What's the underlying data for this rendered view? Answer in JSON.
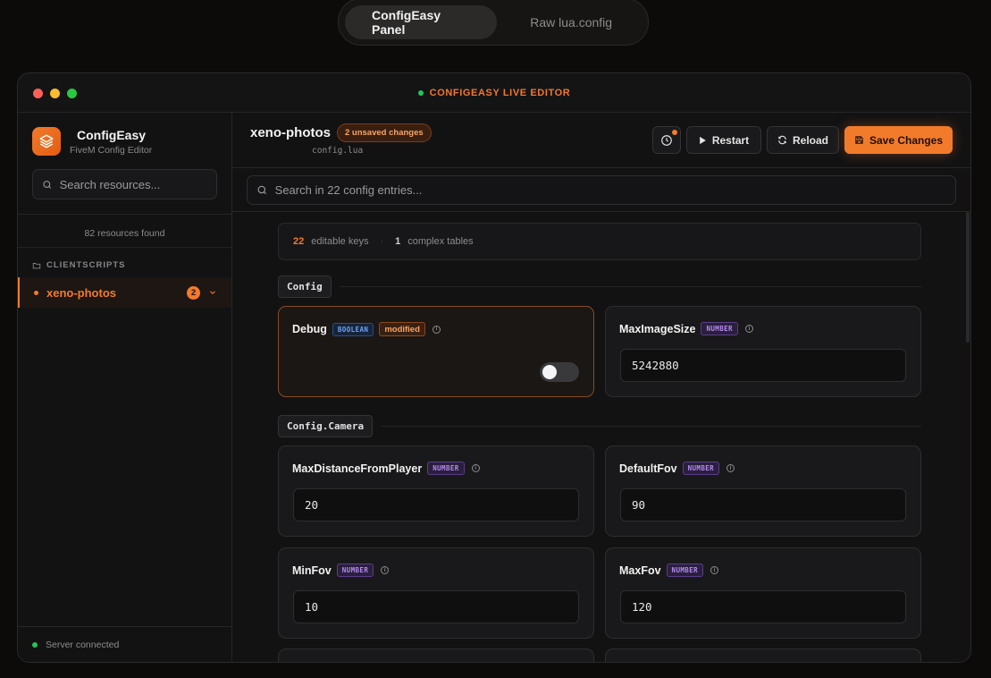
{
  "top_tabs": [
    {
      "label": "ConfigEasy Panel",
      "active": true
    },
    {
      "label": "Raw lua.config",
      "active": false
    }
  ],
  "window": {
    "title": "CONFIGEASY LIVE EDITOR"
  },
  "sidebar": {
    "brand_title": "ConfigEasy",
    "brand_subtitle": "FiveM Config Editor",
    "search_placeholder": "Search resources...",
    "resource_count": "82 resources found",
    "group_label": "CLIENTSCRIPTS",
    "items": [
      {
        "name": "xeno-photos",
        "badge": "2",
        "active": true
      }
    ],
    "footer_status": "Server connected"
  },
  "header": {
    "resource_name": "xeno-photos",
    "unsaved_badge": "2 unsaved changes",
    "file_name": "config.lua",
    "restart_label": "Restart",
    "reload_label": "Reload",
    "save_label": "Save Changes"
  },
  "search": {
    "placeholder": "Search in 22 config entries..."
  },
  "stats": {
    "editable_count": "22",
    "editable_label": "editable keys",
    "complex_count": "1",
    "complex_label": "complex tables"
  },
  "sections": [
    {
      "name": "Config",
      "entries": [
        {
          "key": "Debug",
          "type": "BOOLEAN",
          "modified_label": "modified",
          "value": false
        },
        {
          "key": "MaxImageSize",
          "type": "NUMBER",
          "value": "5242880"
        }
      ]
    },
    {
      "name": "Config.Camera",
      "entries": [
        {
          "key": "MaxDistanceFromPlayer",
          "type": "NUMBER",
          "value": "20"
        },
        {
          "key": "DefaultFov",
          "type": "NUMBER",
          "value": "90"
        },
        {
          "key": "MinFov",
          "type": "NUMBER",
          "value": "10"
        },
        {
          "key": "MaxFov",
          "type": "NUMBER",
          "value": "120"
        }
      ]
    }
  ],
  "colors": {
    "accent": "#f27b2b",
    "success": "#22c55e",
    "background": "#0d0b0a",
    "number_type": "#b58af0",
    "boolean_type": "#6fa3f0"
  }
}
